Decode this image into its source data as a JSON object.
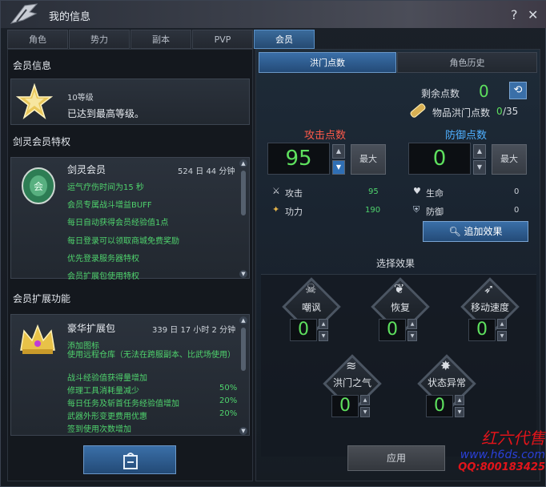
{
  "window": {
    "title": "我的信息",
    "help": "?",
    "close": "✕"
  },
  "tabs": [
    "角色",
    "势力",
    "副本",
    "PVP",
    "会员"
  ],
  "left": {
    "member_info_header": "会员信息",
    "level": {
      "label": "10等级",
      "text": "已达到最高等级。"
    },
    "privilege_header": "剑灵会员特权",
    "privilege_card": {
      "name": "剑灵会员",
      "time": "524 日 44 分钟",
      "items": [
        "运气疗伤时间为15 秒",
        "会员专属战斗增益BUFF",
        "每日自动获得会员经验值1点",
        "每日登录可以领取商城免费奖励",
        "优先登录服务器特权",
        "会员扩展包使用特权"
      ]
    },
    "ext_header": "会员扩展功能",
    "ext_card": {
      "name": "豪华扩展包",
      "time": "339 日 17 小时 2 分钟",
      "items": [
        {
          "text": "添加图标",
          "value": ""
        },
        {
          "text": "使用远程仓库（无法在跨服副本、比武场使用）",
          "value": ""
        },
        {
          "text": "战斗经验值获得量增加",
          "value": ""
        },
        {
          "text": "修理工具消耗量减少",
          "value": "50%"
        },
        {
          "text": "每日任务及斩首任务经验值增加",
          "value": "20%"
        },
        {
          "text": "武器外形变更费用优惠",
          "value": "20%"
        },
        {
          "text": "签到使用次数增加",
          "value": ""
        }
      ]
    }
  },
  "right": {
    "subtabs": [
      "洪门点数",
      "角色历史"
    ],
    "remaining_label": "剩余点数",
    "remaining_value": "0",
    "item_points_label": "物品洪门点数",
    "item_points_value": "0",
    "item_points_max": "/35",
    "attack_label": "攻击点数",
    "defense_label": "防御点数",
    "attack_value": "95",
    "defense_value": "0",
    "max_label": "最大",
    "stats": [
      {
        "name": "攻击",
        "value": "95",
        "icon": "swords-icon"
      },
      {
        "name": "生命",
        "value": "0",
        "icon": "heart-icon"
      },
      {
        "name": "功力",
        "value": "190",
        "icon": "flame-icon"
      },
      {
        "name": "防御",
        "value": "0",
        "icon": "shield-icon"
      }
    ],
    "add_effect_button": "追加效果",
    "select_effect_header": "选择效果",
    "effects": [
      {
        "name": "嘲讽",
        "value": "0",
        "icon": "skull-icon"
      },
      {
        "name": "恢复",
        "value": "0",
        "icon": "sprout-icon"
      },
      {
        "name": "移动速度",
        "value": "0",
        "icon": "wing-icon"
      },
      {
        "name": "洪门之气",
        "value": "0",
        "icon": "storm-icon"
      },
      {
        "name": "状态异常",
        "value": "0",
        "icon": "spark-icon"
      }
    ],
    "apply_button": "应用"
  },
  "watermark": {
    "line1": "红六代售",
    "line2": "www.h6ds.com",
    "line3": "QQ:800183425"
  },
  "colors": {
    "green": "#4fd36d",
    "blue_tab": "#2f6fb5",
    "watermark_red": "#e2141a"
  }
}
